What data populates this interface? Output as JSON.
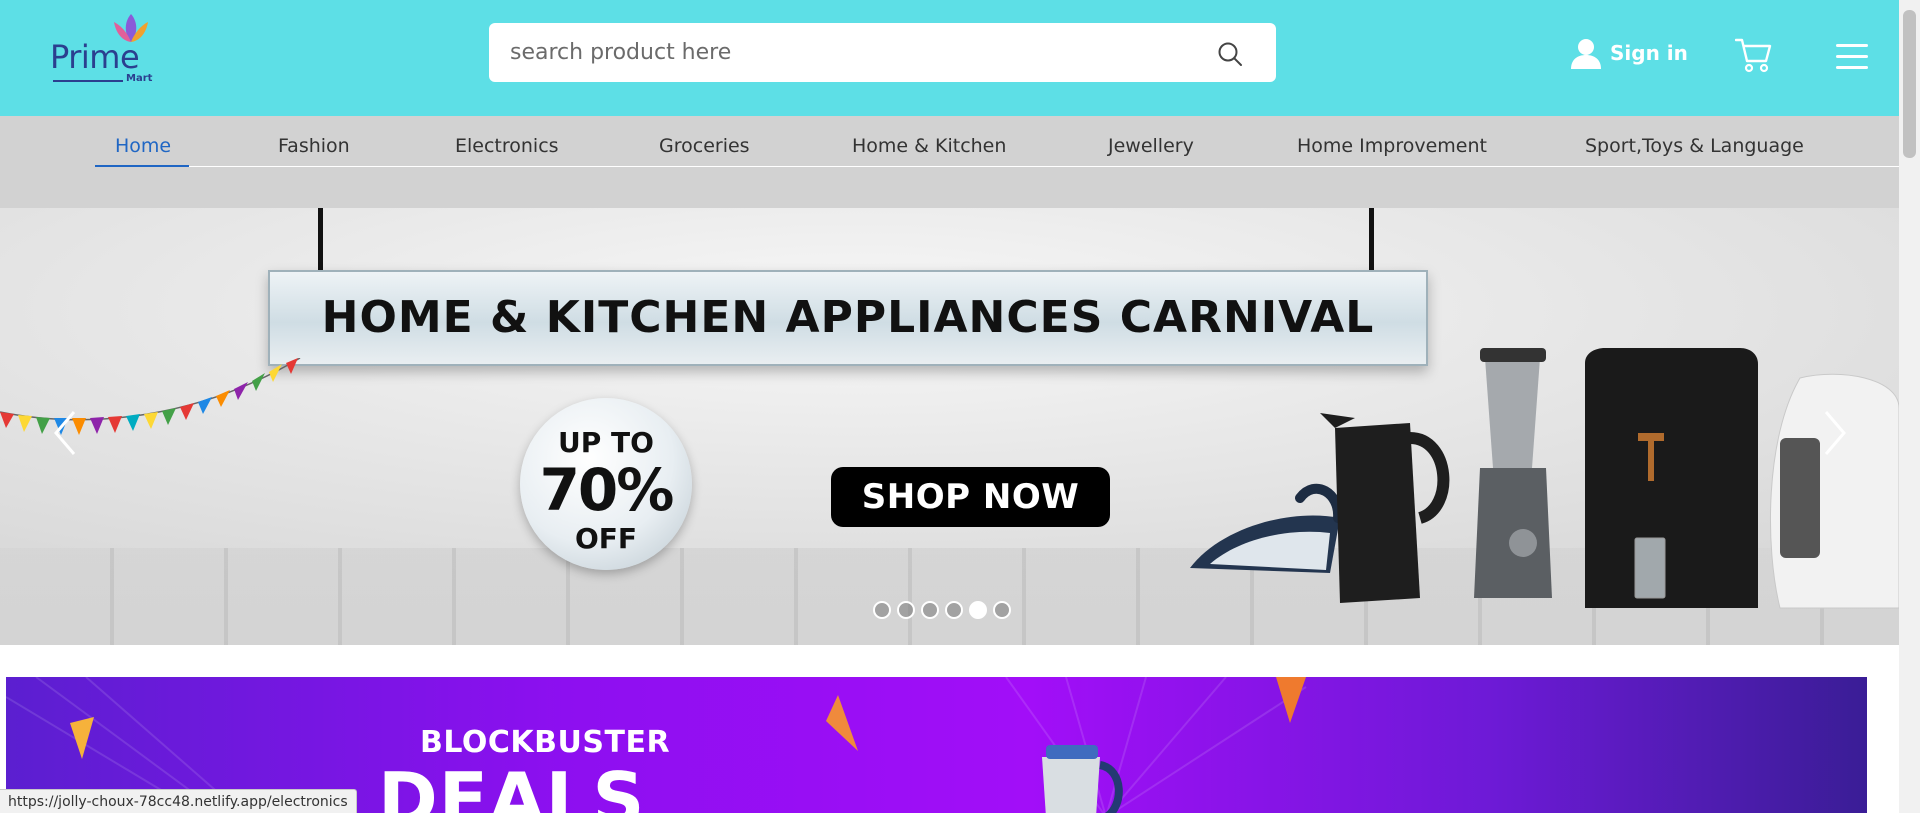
{
  "brand": {
    "name": "Prime",
    "sub": "Mart"
  },
  "search": {
    "placeholder": "search product here"
  },
  "account": {
    "sign_in_label": "Sign in"
  },
  "nav": {
    "items": [
      {
        "label": "Home",
        "active": true
      },
      {
        "label": "Fashion"
      },
      {
        "label": "Electronics"
      },
      {
        "label": "Groceries"
      },
      {
        "label": "Home & Kitchen"
      },
      {
        "label": "Jewellery"
      },
      {
        "label": "Home Improvement"
      },
      {
        "label": "Sport,Toys & Language"
      }
    ]
  },
  "hero": {
    "headline": "HOME & KITCHEN APPLIANCES CARNIVAL",
    "badge_line1": "UP TO",
    "badge_line2": "70%",
    "badge_line3": "OFF",
    "cta": "SHOP NOW",
    "slide_count": 6,
    "active_slide": 5
  },
  "deals": {
    "line1": "BLOCKBUSTER",
    "line2": "DEALS"
  },
  "status_url": "https://jolly-choux-78cc48.netlify.app/electronics",
  "colors": {
    "header_bg": "#5ddfe6",
    "nav_bg": "#d2d2d2",
    "nav_active": "#1f66c4",
    "deals_purple": "#a20ef8"
  },
  "icons": {
    "search": "search-icon",
    "user": "user-icon",
    "cart": "cart-icon",
    "menu": "hamburger-menu-icon",
    "prev": "chevron-left-icon",
    "next": "chevron-right-icon"
  }
}
